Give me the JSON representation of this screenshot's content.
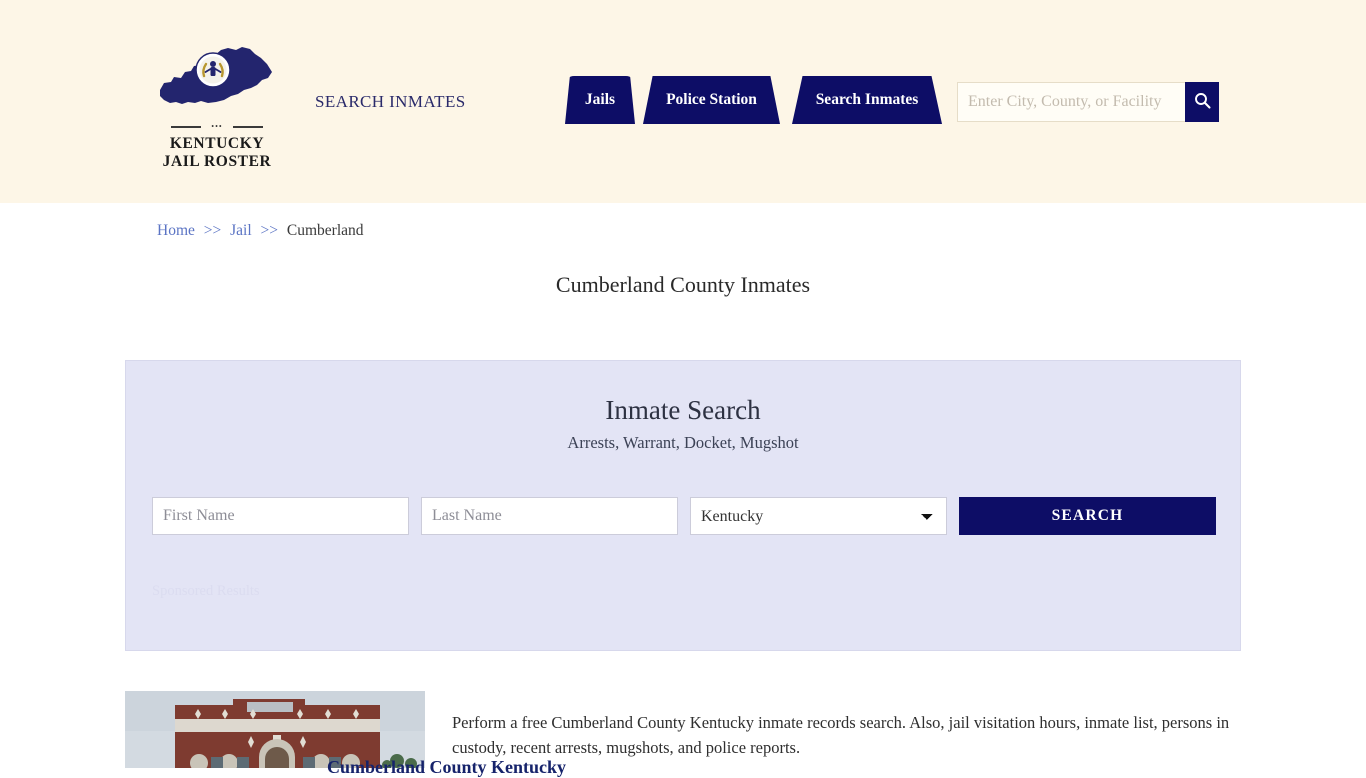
{
  "header": {
    "logo": {
      "icon": "kentucky-state-map-icon",
      "line1": "KENTUCKY",
      "line2": "JAIL ROSTER",
      "map_color": "#23256e",
      "seal_color": "#ffffff"
    },
    "tagline": "SEARCH INMATES",
    "nav": [
      {
        "label": "Jails"
      },
      {
        "label": "Police Station"
      },
      {
        "label": "Search Inmates"
      }
    ],
    "search": {
      "placeholder": "Enter City, County, or Facility",
      "value": "",
      "button_icon": "search-icon"
    },
    "background_color": "#fdf6e7",
    "accent_color": "#0d0d66"
  },
  "breadcrumb": {
    "items": [
      {
        "label": "Home",
        "link": true
      },
      {
        "label": "Jail",
        "link": true
      },
      {
        "label": "Cumberland",
        "link": false
      }
    ],
    "separator": ">>",
    "link_color": "#5b74c4"
  },
  "page": {
    "title": "Cumberland County Inmates"
  },
  "panel": {
    "title": "Inmate Search",
    "subtitle": "Arrests, Warrant, Docket, Mugshot",
    "background_color": "#e3e4f5",
    "form": {
      "first_name_placeholder": "First Name",
      "first_name_value": "",
      "last_name_placeholder": "Last Name",
      "last_name_value": "",
      "state_selected": "Kentucky",
      "state_options": [
        "Kentucky"
      ],
      "search_label": "SEARCH"
    },
    "sponsored_label": "Sponsored Results"
  },
  "content": {
    "thumbnail_alt": "Cumberland County courthouse building",
    "paragraph": "Perform a free Cumberland County Kentucky inmate records search. Also, jail visitation hours, inmate list, persons in custody, recent arrests, mugshots, and police reports.",
    "heading": "Cumberland County Kentucky",
    "heading_color": "#16236b"
  }
}
